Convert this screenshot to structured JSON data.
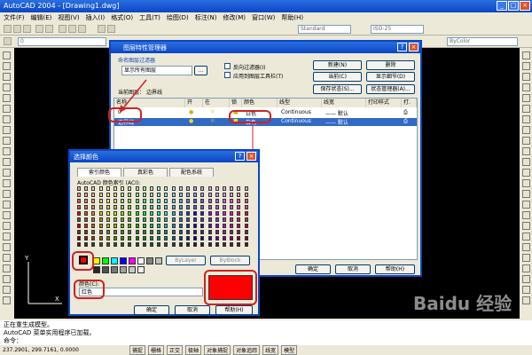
{
  "app": {
    "title": "AutoCAD 2004 - [Drawing1.dwg]",
    "menu": [
      "文件(F)",
      "编辑(E)",
      "视图(V)",
      "插入(I)",
      "格式(O)",
      "工具(T)",
      "绘图(D)",
      "标注(N)",
      "修改(M)",
      "窗口(W)",
      "帮助(H)"
    ],
    "toolbar": {
      "text_style": "Standard",
      "dim_style": "ISO-25",
      "layer_combo": "0",
      "color_combo": "ByColor"
    },
    "command_lines": [
      "正在重生成模型。",
      "AutoCAD 菜单实用程序已加载。",
      "命令："
    ],
    "coords": "237.2901, 299.7161, 0.0000",
    "status_buttons": [
      "捕捉",
      "栅格",
      "正交",
      "极轴",
      "对象捕捉",
      "对象追踪",
      "线宽",
      "模型"
    ],
    "axis_y": "Y",
    "axis_x": "X"
  },
  "layer_dialog": {
    "title": "图层特性管理器",
    "filter_group": "命名图层过滤器",
    "filter_value": "显示所有图层",
    "invert_filter": "反向过滤器(I)",
    "apply_toolbar": "应用到图层工具栏(T)",
    "current_layer_label": "当前图层：",
    "current_layer": "边界线",
    "btn_new": "新建(N)",
    "btn_delete": "删除",
    "btn_current": "当前(C)",
    "btn_details": "显示细节(D)",
    "btn_save_state": "保存状态(S)...",
    "btn_state_mgr": "状态管理器(A)...",
    "columns": [
      "名称",
      "开",
      "在",
      "锁",
      "颜色",
      "线型",
      "线宽",
      "打印样式",
      "打."
    ],
    "rows": [
      {
        "name": "0",
        "color": "白色",
        "linetype": "Continuous",
        "lineweight": "—— 默认"
      },
      {
        "name": "边界线",
        "color": "白色",
        "linetype": "Continuous",
        "lineweight": "—— 默认"
      }
    ],
    "btn_ok": "确定",
    "btn_cancel": "取消",
    "btn_help": "帮助(H)",
    "close_glyph": "×",
    "help_glyph": "?"
  },
  "color_dialog": {
    "title": "选择颜色",
    "tabs": [
      "索引颜色",
      "真彩色",
      "配色系统"
    ],
    "palette_label": "AutoCAD 颜色索引 (ACI):",
    "btn_bylayer": "ByLayer",
    "btn_byblock": "ByBlock",
    "color_label": "颜色(C):",
    "color_value": "红色",
    "btn_ok": "确定",
    "btn_cancel": "取消",
    "btn_help": "帮助(H)",
    "selected_color": "#ff0000",
    "close_glyph": "×",
    "help_glyph": "?"
  },
  "watermark": "Baidu 经验",
  "colors": {
    "title_blue": "#0a46c4",
    "selection_blue": "#316ac5",
    "highlight_red": "#d42020"
  }
}
